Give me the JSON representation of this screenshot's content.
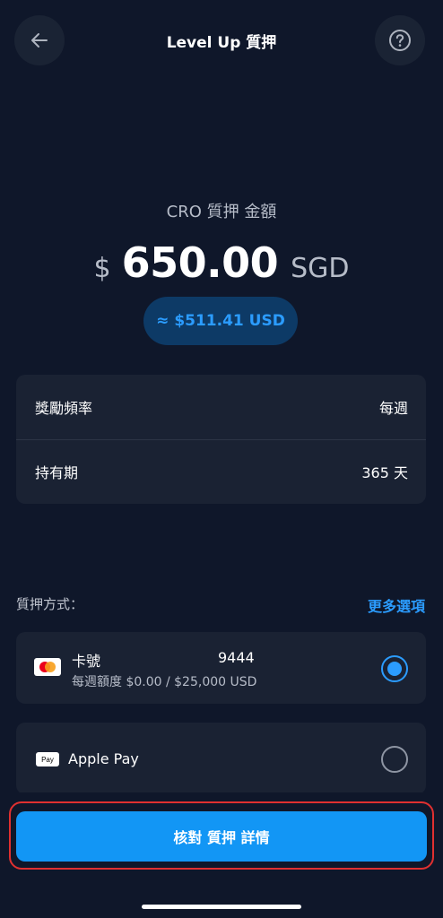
{
  "header": {
    "title": "Level Up 質押",
    "back_icon": "arrow-left-icon",
    "help_icon": "question-circle-icon"
  },
  "amount": {
    "label": "CRO 質押 金額",
    "currency_symbol": "$",
    "value": "650.00",
    "currency": "SGD",
    "usd_equivalent": "≈ $511.41 USD"
  },
  "info": {
    "rows": [
      {
        "label": "獎勵頻率",
        "value": "每週"
      },
      {
        "label": "持有期",
        "value": "365 天"
      }
    ]
  },
  "payment": {
    "label": "質押方式：",
    "more_options": "更多選項",
    "methods": [
      {
        "title": "卡號",
        "number": "9444",
        "subtitle": "每週額度 $0.00 / $25,000 USD",
        "selected": true,
        "icon": "mastercard-icon"
      },
      {
        "title": "Apple Pay",
        "badge": "Pay",
        "selected": false,
        "icon": "apple-pay-icon"
      }
    ]
  },
  "cta": {
    "label": "核對 質押 詳情"
  },
  "colors": {
    "background": "#0f172a",
    "card": "#1a2233",
    "accent": "#2b9cff",
    "cta": "#1296f5",
    "highlight": "#e03030"
  }
}
